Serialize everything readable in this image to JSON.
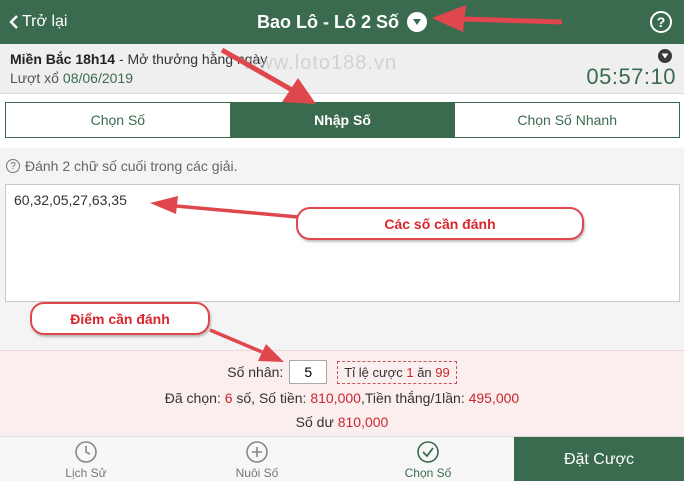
{
  "header": {
    "back_label": "Trở lại",
    "title": "Bao Lô - Lô 2 Số",
    "help": "?"
  },
  "draw": {
    "region": "Miền Bắc 18h14",
    "schedule": " - Mở thưởng hằng ngày",
    "round_label": "Lượt xổ",
    "date": "08/06/2019",
    "timer": "05:57:10"
  },
  "watermark": "www.loto188.vn",
  "tabs": [
    {
      "label": "Chọn Số"
    },
    {
      "label": "Nhập Số"
    },
    {
      "label": "Chọn Số Nhanh"
    }
  ],
  "hint": "Đánh 2 chữ số cuối trong các giải.",
  "numbers_value": "60,32,05,27,63,35",
  "annotations": {
    "numbers_callout": "Các số cần đánh",
    "points_callout": "Điểm cần đánh"
  },
  "summary": {
    "multiplier_label": "Số nhân:",
    "multiplier_value": "5",
    "odds_prefix": "Tỉ lệ cược",
    "odds_bet": "1",
    "odds_mid": "ăn",
    "odds_win": "99",
    "selected_label": "Đã chọn:",
    "selected_count": "6",
    "selected_unit": "số, Số tiền:",
    "amount": "810,000",
    "win_label": ",Tiền thắng/1lần:",
    "win_amount": "495,000",
    "balance_label": "Số dư",
    "balance": "810,000"
  },
  "nav": {
    "history": "Lịch Sử",
    "nuoi": "Nuôi Số",
    "choose": "Chọn Số",
    "place_bet": "Đặt Cược"
  },
  "colors": {
    "primary": "#3b6b4e",
    "accent_red": "#c9272d",
    "annotation": "#e0474c"
  }
}
